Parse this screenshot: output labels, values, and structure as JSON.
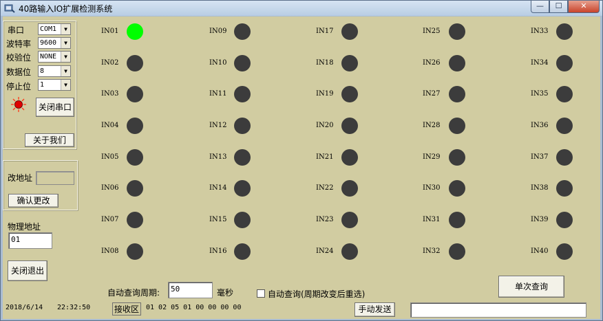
{
  "window": {
    "title": "40路输入IO扩展检测系统",
    "min_glyph": "—",
    "max_glyph": "☐",
    "close_glyph": "✕"
  },
  "serial": {
    "port_label": "串口",
    "port_value": "COM1",
    "baud_label": "波特率",
    "baud_value": "9600",
    "parity_label": "校验位",
    "parity_value": "NONE",
    "databits_label": "数据位",
    "databits_value": "8",
    "stopbits_label": "停止位",
    "stopbits_value": "1",
    "close_port_button": "关闭串口",
    "about_button": "关于我们"
  },
  "address": {
    "change_label": "改地址",
    "change_value": "",
    "confirm_button": "确认更改"
  },
  "physical_address": {
    "label": "物理地址",
    "value": "01"
  },
  "exit_button": "关闭退出",
  "io_inputs": [
    {
      "label": "IN01",
      "on": true
    },
    {
      "label": "IN02",
      "on": false
    },
    {
      "label": "IN03",
      "on": false
    },
    {
      "label": "IN04",
      "on": false
    },
    {
      "label": "IN05",
      "on": false
    },
    {
      "label": "IN06",
      "on": false
    },
    {
      "label": "IN07",
      "on": false
    },
    {
      "label": "IN08",
      "on": false
    },
    {
      "label": "IN09",
      "on": false
    },
    {
      "label": "IN10",
      "on": false
    },
    {
      "label": "IN11",
      "on": false
    },
    {
      "label": "IN12",
      "on": false
    },
    {
      "label": "IN13",
      "on": false
    },
    {
      "label": "IN14",
      "on": false
    },
    {
      "label": "IN15",
      "on": false
    },
    {
      "label": "IN16",
      "on": false
    },
    {
      "label": "IN17",
      "on": false
    },
    {
      "label": "IN18",
      "on": false
    },
    {
      "label": "IN19",
      "on": false
    },
    {
      "label": "IN20",
      "on": false
    },
    {
      "label": "IN21",
      "on": false
    },
    {
      "label": "IN22",
      "on": false
    },
    {
      "label": "IN23",
      "on": false
    },
    {
      "label": "IN24",
      "on": false
    },
    {
      "label": "IN25",
      "on": false
    },
    {
      "label": "IN26",
      "on": false
    },
    {
      "label": "IN27",
      "on": false
    },
    {
      "label": "IN28",
      "on": false
    },
    {
      "label": "IN29",
      "on": false
    },
    {
      "label": "IN30",
      "on": false
    },
    {
      "label": "IN31",
      "on": false
    },
    {
      "label": "IN32",
      "on": false
    },
    {
      "label": "IN33",
      "on": false
    },
    {
      "label": "IN34",
      "on": false
    },
    {
      "label": "IN35",
      "on": false
    },
    {
      "label": "IN36",
      "on": false
    },
    {
      "label": "IN37",
      "on": false
    },
    {
      "label": "IN38",
      "on": false
    },
    {
      "label": "IN39",
      "on": false
    },
    {
      "label": "IN40",
      "on": false
    }
  ],
  "query": {
    "period_label": "自动查询周期:",
    "period_value": "50",
    "unit": "毫秒",
    "auto_label": "自动查询(周期改变后重选)",
    "auto_checked": false,
    "single_button": "单次查询"
  },
  "status": {
    "date": "2018/6/14",
    "time": "22:32:50",
    "recv_label": "接收区",
    "recv_data": "01 02 05 01 00 00 00 00",
    "send_button": "手动发送",
    "send_value": ""
  },
  "colors": {
    "led_on": "#00ff00",
    "led_off": "#3c3c3c",
    "panel": "#d1cca1"
  }
}
